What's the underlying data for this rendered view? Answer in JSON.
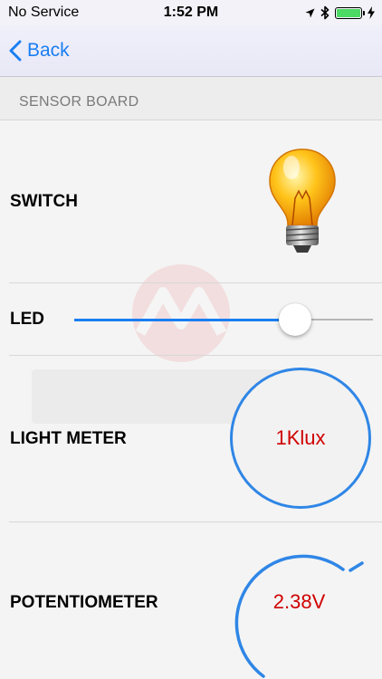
{
  "status_bar": {
    "carrier": "No Service",
    "time": "1:52 PM",
    "battery_level": 1.0
  },
  "nav": {
    "back_label": "Back"
  },
  "section": {
    "title": "SENSOR BOARD"
  },
  "rows": {
    "switch": {
      "label": "SWITCH",
      "icon": "light-bulb-icon"
    },
    "led": {
      "label": "LED",
      "level": 0.77
    },
    "light_meter": {
      "label": "LIGHT METER",
      "value": "1Klux"
    },
    "potentiometer": {
      "label": "POTENTIOMETER",
      "value": "2.38V"
    }
  },
  "colors": {
    "accent": "#1a7ef2",
    "value_text": "#d00000",
    "gauge_ring": "#2f86e6"
  }
}
